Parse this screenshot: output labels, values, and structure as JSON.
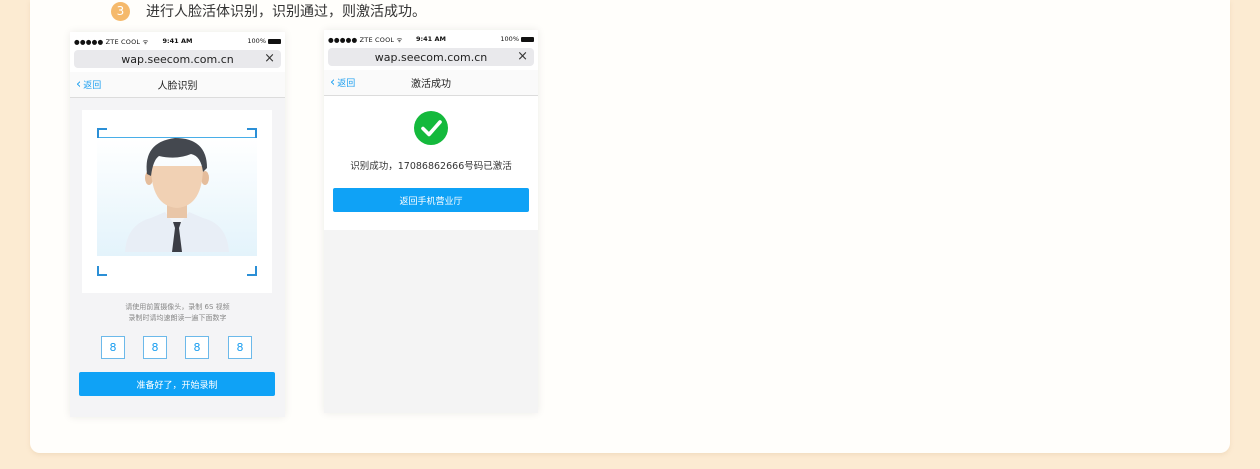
{
  "step": {
    "number": "3",
    "text": "进行人脸活体识别，识别通过，则激活成功。"
  },
  "status_bar": {
    "carrier": "●●●●● ZTE COOL",
    "wifi_glyph": "ᯤ",
    "time": "9:41 AM",
    "battery": "100%"
  },
  "browser": {
    "url": "wap.seecom.com.cn",
    "close_glyph": "×"
  },
  "face_screen": {
    "back": {
      "glyph": "‹",
      "label": "返回"
    },
    "title": "人脸识别",
    "hint_line1": "请使用前置摄像头，录制 6S 视频",
    "hint_line2": "录制时请均速朗读一遍下面数字",
    "codes": [
      "8",
      "8",
      "8",
      "8"
    ],
    "start_button": "准备好了，开始录制"
  },
  "success_screen": {
    "back": {
      "glyph": "‹",
      "label": "返回"
    },
    "title": "激活成功",
    "message": "识别成功，17086862666号码已激活",
    "return_button": "返回手机营业厅"
  },
  "colors": {
    "accent": "#0fa2f6",
    "success": "#14b93c",
    "step_badge": "#f5b96b",
    "page_bg": "#fcebd2"
  }
}
